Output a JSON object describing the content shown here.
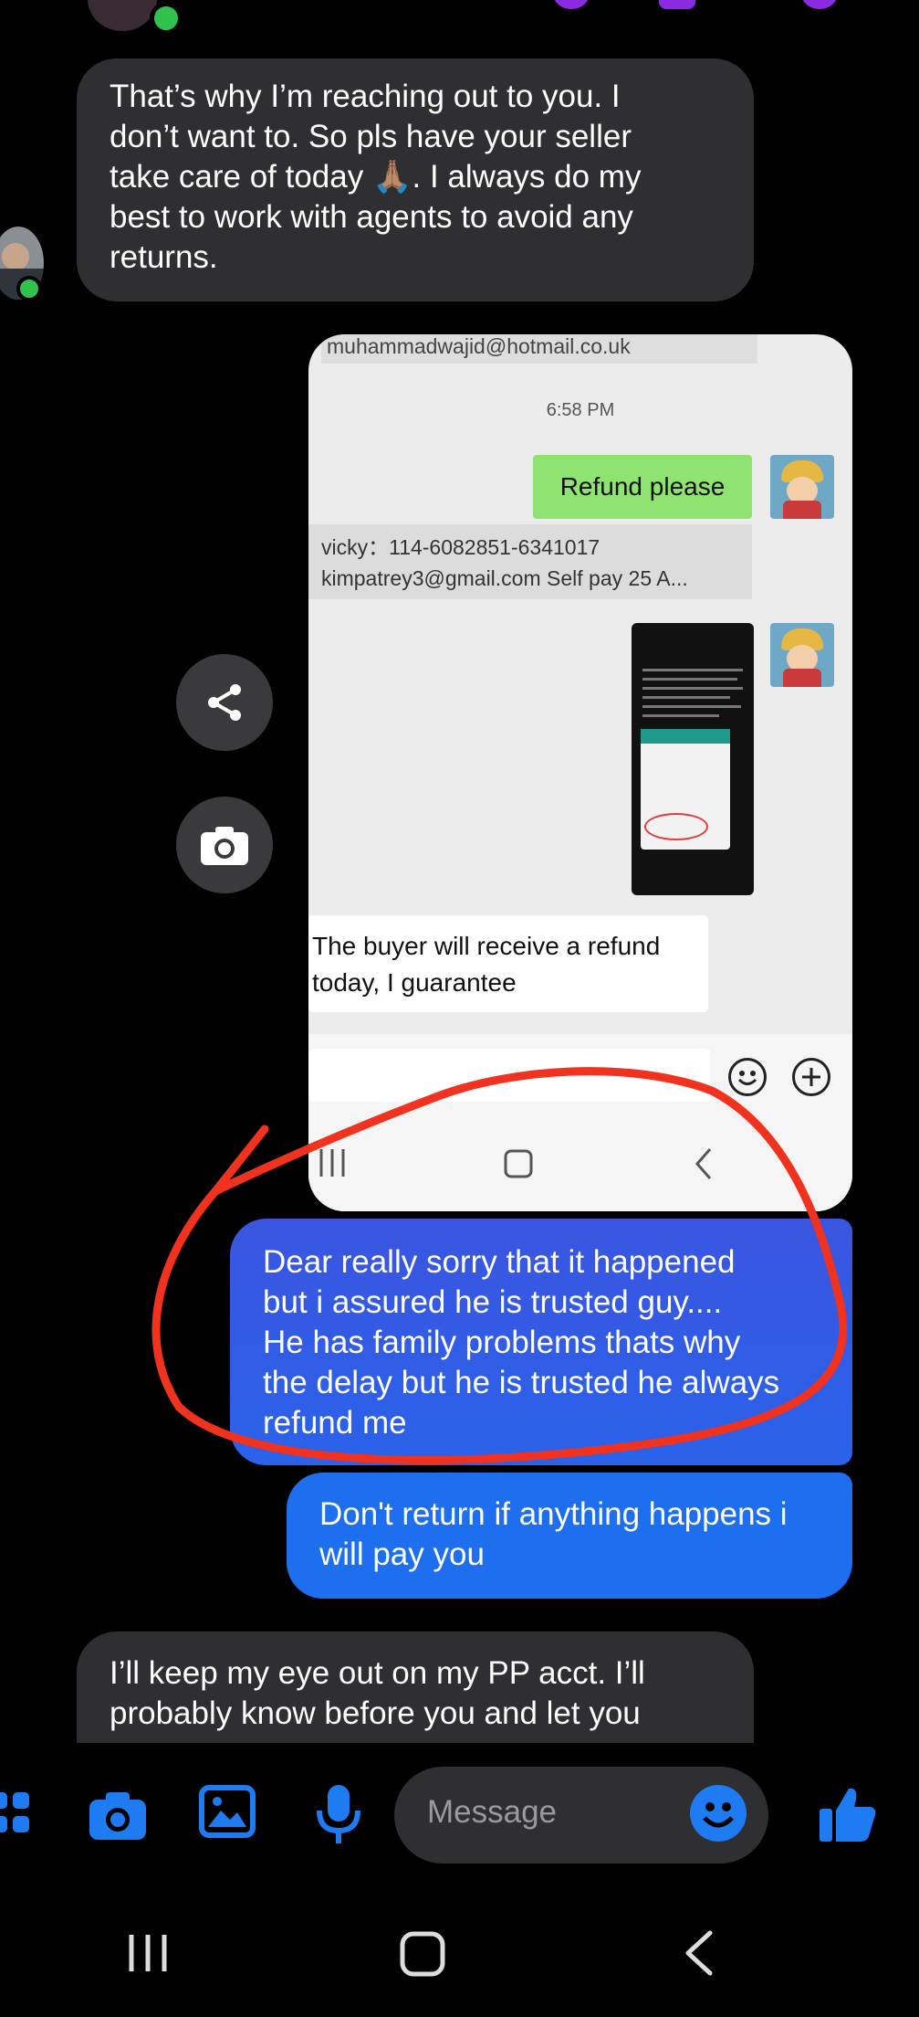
{
  "messages": {
    "in_1": [
      "That’s why I’m reaching out to you. I",
      "don’t want to. So pls have your seller",
      "take care of today 🙏🏽.  I always do my",
      "best to work with agents to avoid any",
      "returns."
    ],
    "out_1": [
      "Dear really sorry that it happened",
      "but i assured he is trusted guy....",
      "He has family problems thats why",
      "the delay but he is trusted he always",
      "refund me"
    ],
    "out_2": [
      "Don't return if anything happens i",
      "will pay you"
    ],
    "in_2": [
      "I’ll keep my eye out on my PP acct. I’ll",
      "probably know before you and let you"
    ]
  },
  "shared_image": {
    "email": "muhammadwajid@hotmail.co.uk",
    "time": "6:58 PM",
    "refund_msg": "Refund please",
    "order_line1": "vicky：114-6082851-6341017",
    "order_line2": "kimpatrey3@gmail.com  Self pay 25  A...",
    "guarantee_line1": "The buyer will receive a refund",
    "guarantee_line2": "today, I guarantee"
  },
  "composer": {
    "placeholder": "Message"
  },
  "colors": {
    "incoming_bubble": "#2f2f31",
    "outgoing_bubble_top": "#3a55e0",
    "outgoing_bubble_bottom": "#1e6ff0",
    "accent": "#1e7bf2",
    "annotation_red": "#f0321e",
    "refund_green": "#8fe370"
  },
  "icons": [
    "share-icon",
    "camera-icon",
    "apps-icon",
    "image-icon",
    "microphone-icon",
    "emoji-icon",
    "thumbs-up-icon",
    "recent-apps-icon",
    "home-icon",
    "back-icon"
  ]
}
